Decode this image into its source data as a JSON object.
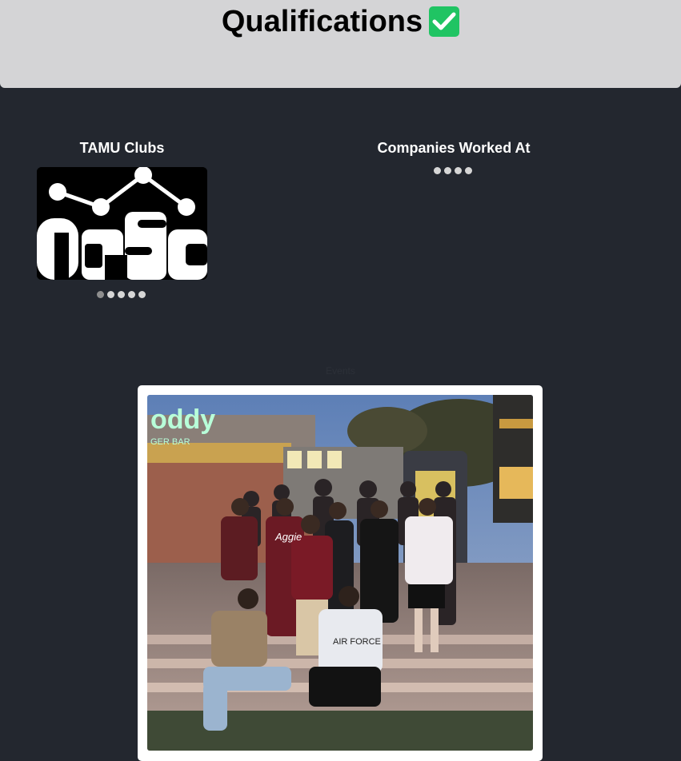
{
  "header": {
    "title": "Qualifications",
    "badge_icon": "check-mark-button-icon",
    "background": "#d4d4d6",
    "badge_color": "#20c463"
  },
  "clubs": {
    "title": "TAMU Clubs",
    "logo_text": "AIDSC",
    "carousel": {
      "count": 5,
      "active_index": 0
    }
  },
  "companies": {
    "title": "Companies Worked At",
    "carousel": {
      "count": 4,
      "active_index": 0
    }
  },
  "events": {
    "label": "Events",
    "photo_sign_text": "oddy",
    "photo_sign_subtext": "GER BAR",
    "shirt_text_1": "Aggie",
    "shirt_text_2": "AIR FORCE"
  },
  "colors": {
    "page_background": "#23272f",
    "text": "#ffffff",
    "dot": "#d6d6d6",
    "dot_active": "#8e8e8e"
  }
}
